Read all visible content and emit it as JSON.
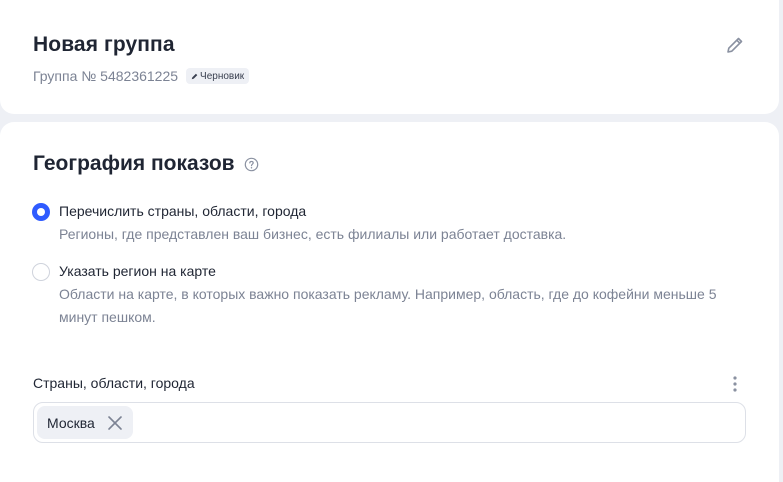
{
  "group": {
    "title": "Новая группа",
    "number_label": "Группа № 5482361225",
    "status_badge": "Черновик"
  },
  "geo": {
    "title": "География показов",
    "options": [
      {
        "label": "Перечислить страны, области, города",
        "description": "Регионы, где представлен ваш бизнес, есть филиалы или работает доставка.",
        "selected": true
      },
      {
        "label": "Указать регион на карте",
        "description": "Области на карте, в которых важно показать рекламу. Например, область, где до кофейни меньше 5 минут пешком.",
        "selected": false
      }
    ],
    "field_label": "Страны, области, города",
    "tags": [
      "Москва"
    ]
  },
  "colors": {
    "accent": "#2f5bff",
    "text": "#1f2533",
    "muted": "#7c8394",
    "background": "#eef0f5"
  },
  "icons": {
    "edit": "pencil-icon",
    "help": "question-circle-icon",
    "menu": "kebab-menu-icon",
    "remove": "close-icon"
  }
}
